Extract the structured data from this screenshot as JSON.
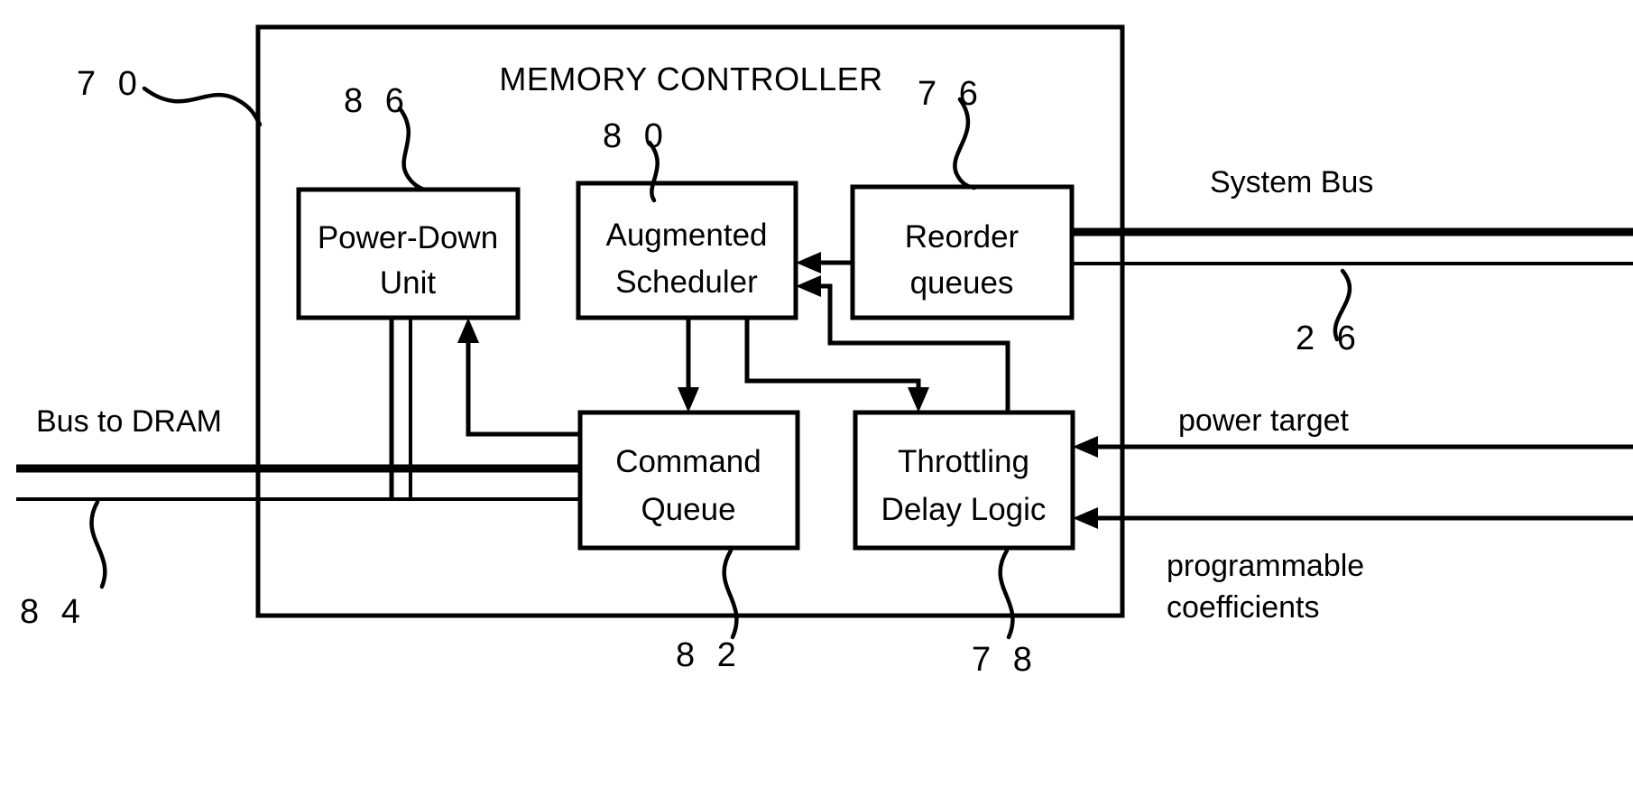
{
  "figure": {
    "title": "MEMORY CONTROLLER",
    "kind": "patent-block-diagram"
  },
  "blocks": [
    {
      "id": "power_down_unit",
      "line1": "Power-Down",
      "line2": "Unit",
      "ref": "8 6"
    },
    {
      "id": "augmented_scheduler",
      "line1": "Augmented",
      "line2": "Scheduler",
      "ref": "8 0"
    },
    {
      "id": "reorder_queues",
      "line1": "Reorder",
      "line2": "queues",
      "ref": "7 6"
    },
    {
      "id": "command_queue",
      "line1": "Command",
      "line2": "Queue",
      "ref": "8 2"
    },
    {
      "id": "throttling_delay_logic",
      "line1": "Throttling",
      "line2": "Delay Logic",
      "ref": "7 8"
    }
  ],
  "external_labels": {
    "system_bus": "System Bus",
    "bus_to_dram": "Bus to DRAM",
    "power_target": "power target",
    "programmable_coefficients_line1": "programmable",
    "programmable_coefficients_line2": "coefficients"
  },
  "reference_numerals": {
    "controller": "7 0",
    "power_down_unit": "8 6",
    "augmented_scheduler": "8 0",
    "reorder_queues": "7 6",
    "system_bus": "2 6",
    "bus_to_dram": "8 4",
    "command_queue": "8 2",
    "throttling_delay_logic": "7 8"
  },
  "colors": {
    "ink": "#000000",
    "paper": "#ffffff"
  }
}
